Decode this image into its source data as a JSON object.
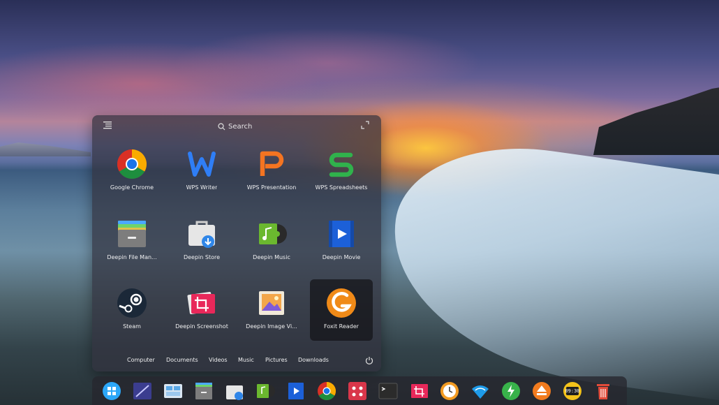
{
  "launcher": {
    "search_label": "Search",
    "apps": [
      {
        "label": "Google Chrome",
        "icon": "chrome-icon"
      },
      {
        "label": "WPS Writer",
        "icon": "wps-writer-icon"
      },
      {
        "label": "WPS Presentation",
        "icon": "wps-presentation-icon"
      },
      {
        "label": "WPS Spreadsheets",
        "icon": "wps-spreadsheets-icon"
      },
      {
        "label": "Deepin File Man...",
        "icon": "file-manager-icon"
      },
      {
        "label": "Deepin Store",
        "icon": "store-icon"
      },
      {
        "label": "Deepin Music",
        "icon": "music-icon"
      },
      {
        "label": "Deepin Movie",
        "icon": "movie-icon"
      },
      {
        "label": "Steam",
        "icon": "steam-icon"
      },
      {
        "label": "Deepin Screenshot",
        "icon": "screenshot-icon"
      },
      {
        "label": "Deepin Image Vi...",
        "icon": "image-viewer-icon"
      },
      {
        "label": "Foxit Reader",
        "icon": "foxit-icon",
        "selected": true
      }
    ],
    "places": [
      "Computer",
      "Documents",
      "Videos",
      "Music",
      "Pictures",
      "Downloads"
    ]
  },
  "dock": {
    "items": [
      "launcher-icon",
      "multitasking-icon",
      "desktop-icon",
      "file-manager-icon",
      "store-icon",
      "music-icon",
      "movie-icon",
      "chrome-icon",
      "app-grid-icon",
      "terminal-icon",
      "screenshot-icon",
      "clock-icon",
      "wifi-icon",
      "power-icon",
      "eject-icon",
      "time-icon",
      "trash-icon"
    ],
    "time_text": "09:30"
  }
}
